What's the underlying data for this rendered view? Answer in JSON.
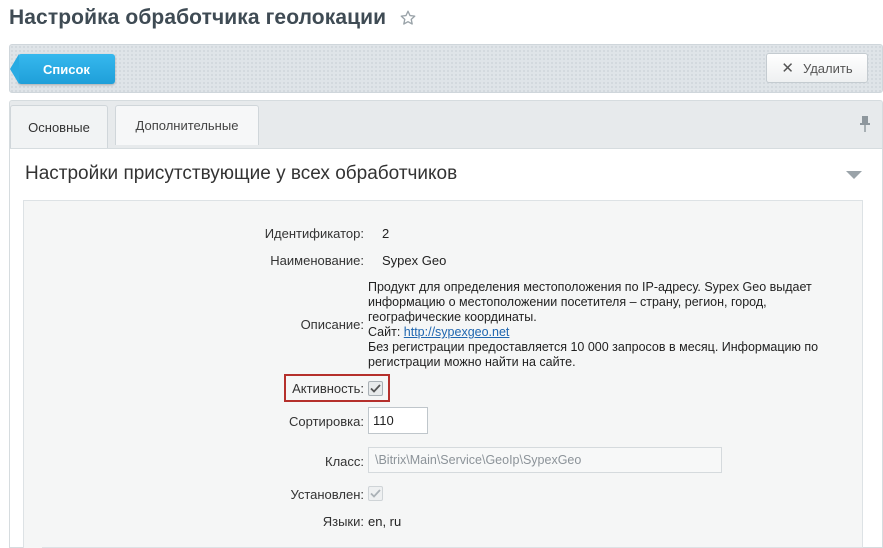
{
  "page": {
    "title": "Настройка обработчика геолокации"
  },
  "toolbar": {
    "list_label": "Список",
    "delete_label": "Удалить"
  },
  "tabs": [
    {
      "label": "Основные"
    },
    {
      "label": "Дополнительные"
    }
  ],
  "section": {
    "title": "Настройки присутствующие у всех обработчиков"
  },
  "form": {
    "id_label": "Идентификатор:",
    "id_value": "2",
    "name_label": "Наименование:",
    "name_value": "Sypex Geo",
    "desc_label": "Описание:",
    "desc_line1": "Продукт для определения местоположения по IP-адресу. Sypex Geo выдает",
    "desc_line2": "информацию о местоположении посетителя – страну, регион, город,",
    "desc_line3": "географические координаты.",
    "desc_site_prefix": "Сайт: ",
    "desc_site_link": "http://sypexgeo.net",
    "desc_line5": "Без регистрации предоставляется 10 000 запросов в месяц. Информацию по",
    "desc_line6": "регистрации можно найти на сайте.",
    "active_label": "Активность:",
    "active_checked": true,
    "sort_label": "Сортировка:",
    "sort_value": "110",
    "class_label": "Класс:",
    "class_value": "\\Bitrix\\Main\\Service\\GeoIp\\SypexGeo",
    "installed_label": "Установлен:",
    "installed_checked": true,
    "langs_label": "Языки:",
    "langs_value": "en, ru"
  },
  "colors": {
    "accent": "#1f9fd9",
    "highlight": "#b5302c",
    "link": "#2067b0"
  }
}
